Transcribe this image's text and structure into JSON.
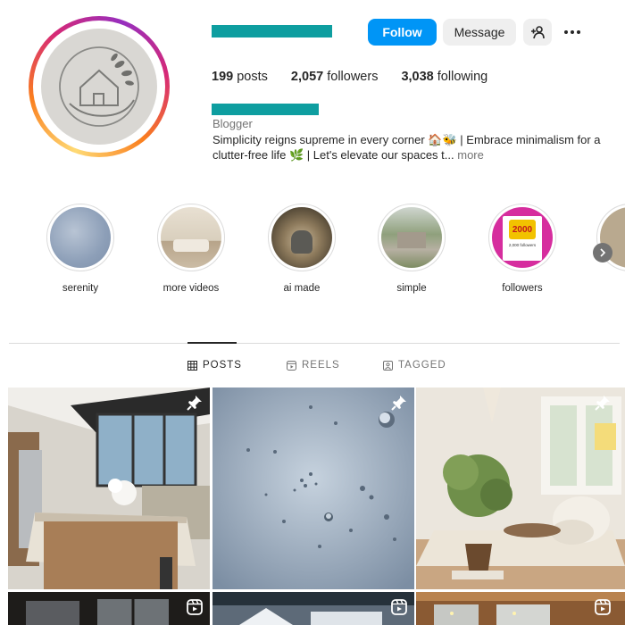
{
  "profile": {
    "posts": "199",
    "posts_label": "posts",
    "followers": "2,057",
    "followers_label": "followers",
    "following": "3,038",
    "following_label": "following",
    "category": "Blogger",
    "bio_line1": "Simplicity reigns supreme in every corner 🏠🐝 | Embrace minimalism for a",
    "bio_line2": "clutter-free life 🌿 | Let's elevate our spaces t...",
    "bio_more": "more"
  },
  "actions": {
    "follow_label": "Follow",
    "message_label": "Message",
    "add_friend_icon": "add-person-icon",
    "more_icon": "more-options-icon"
  },
  "highlights": [
    {
      "label": "serenity"
    },
    {
      "label": "more videos"
    },
    {
      "label": "ai made"
    },
    {
      "label": "simple"
    },
    {
      "label": "followers",
      "badge_number": "2000",
      "badge_caption": "2,000 followers"
    },
    {
      "label": ""
    }
  ],
  "tabs": [
    {
      "label": "POSTS",
      "icon": "grid-icon",
      "active": true
    },
    {
      "label": "REELS",
      "icon": "reels-icon",
      "active": false
    },
    {
      "label": "TAGGED",
      "icon": "tagged-icon",
      "active": false
    }
  ],
  "grid": [
    {
      "type": "kitchen",
      "badge": "pin-icon"
    },
    {
      "type": "raindrops",
      "badge": "pin-icon"
    },
    {
      "type": "living-room",
      "badge": "pin-icon"
    },
    {
      "type": "dark-interior",
      "badge": "reel-icon"
    },
    {
      "type": "snow-house",
      "badge": "reel-icon"
    },
    {
      "type": "wood-porch",
      "badge": "reel-icon"
    }
  ],
  "colors": {
    "accent": "#0095f6",
    "redacted": "#0e9ea0"
  }
}
